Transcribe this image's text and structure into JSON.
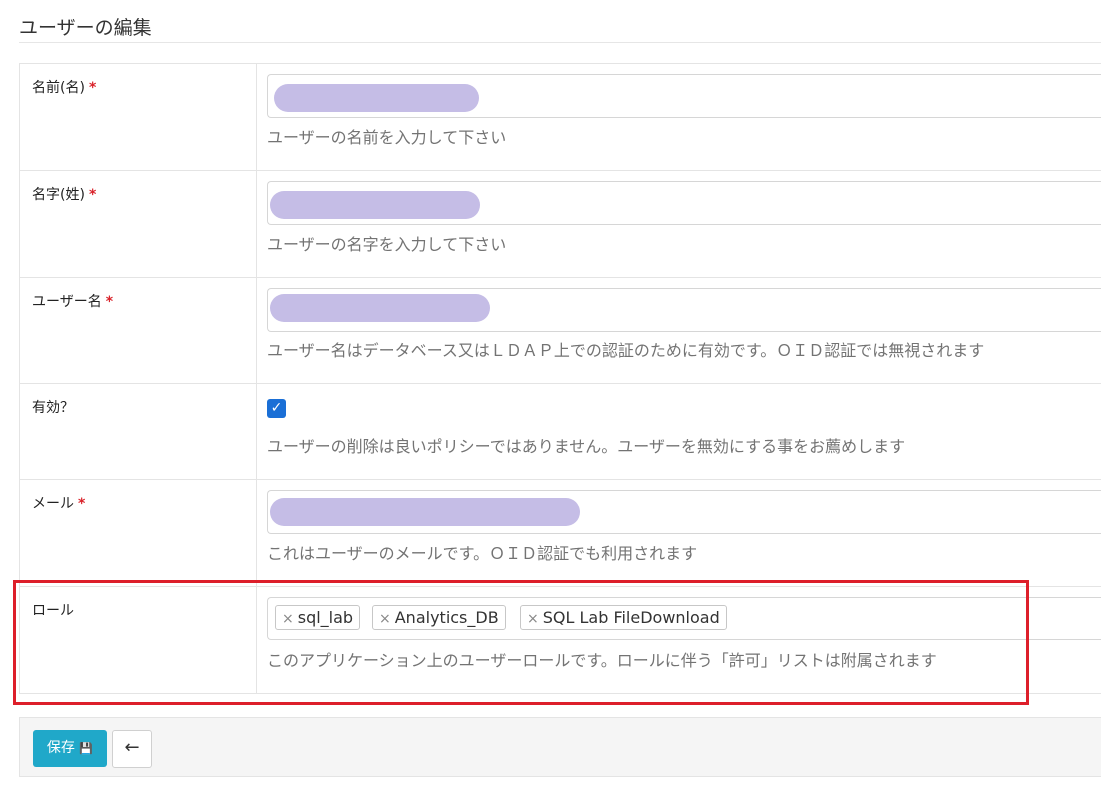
{
  "page": {
    "title": "ユーザーの編集"
  },
  "form": {
    "first_name": {
      "label": "名前(名)",
      "required_mark": "*",
      "help": "ユーザーの名前を入力して下さい"
    },
    "last_name": {
      "label": "名字(姓)",
      "required_mark": "*",
      "help": "ユーザーの名字を入力して下さい"
    },
    "username": {
      "label": "ユーザー名",
      "required_mark": "*",
      "help": "ユーザー名はデータベース又はＬＤＡＰ上での認証のために有効です。ＯＩＤ認証では無視されます"
    },
    "active": {
      "label": "有効？",
      "checked": true,
      "check_glyph": "✓",
      "help": "ユーザーの削除は良いポリシーではありません。ユーザーを無効にする事をお薦めします"
    },
    "email": {
      "label": "メール",
      "required_mark": "*",
      "help": "これはユーザーのメールです。ＯＩＤ認証でも利用されます"
    },
    "roles": {
      "label": "ロール",
      "tags": [
        {
          "remove": "×",
          "text": "sql_lab"
        },
        {
          "remove": "×",
          "text": "Analytics_DB"
        },
        {
          "remove": "×",
          "text": "SQL Lab FileDownload"
        }
      ],
      "help": "このアプリケーション上のユーザーロールです。ロールに伴う「許可」リストは附属されます"
    }
  },
  "actions": {
    "save_label": "保存",
    "save_icon": "💾",
    "back_icon": "←"
  },
  "colors": {
    "accent": "#20a8c9",
    "highlight": "#dd1f2a",
    "redaction": "#c5bde6",
    "required": "#d9222a"
  }
}
